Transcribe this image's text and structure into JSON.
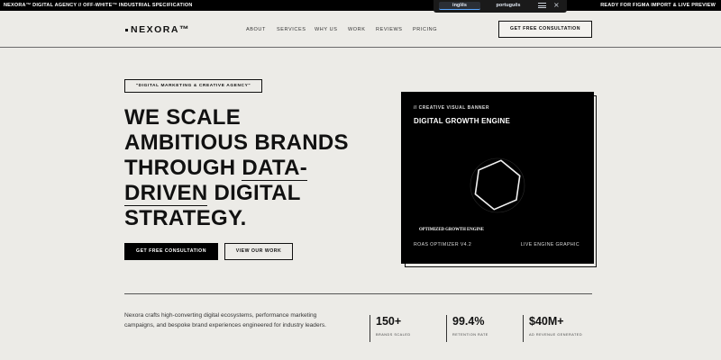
{
  "topbar": {
    "left_text": "NEXORA™ DIGITAL AGENCY // OFF-WHITE™ INDUSTRIAL SPECIFICATION",
    "right_text": "READY FOR FIGMA IMPORT & LIVE PREVIEW"
  },
  "language_switcher": {
    "options": [
      "inglês",
      "português"
    ],
    "selected": "inglês",
    "close_glyph": "×",
    "accent_color": "#5aa7ff"
  },
  "nav": {
    "logo": "NEXORA™",
    "links": [
      "ABOUT",
      "SERVICES",
      "WHY US",
      "WORK",
      "REVIEWS",
      "PRICING"
    ],
    "cta": "GET FREE CONSULTATION"
  },
  "hero": {
    "tag": "\"DIGITAL MARKETING & CREATIVE AGENCY\"",
    "headline": {
      "line1": "WE SCALE",
      "line2": "AMBITIOUS BRANDS",
      "line3_pre": "THROUGH ",
      "line3_ul": "DATA-",
      "line4_ul": "DRIVEN",
      "line4_post": " DIGITAL",
      "line5": "STRATEGY."
    },
    "primary_cta": "GET FREE CONSULTATION",
    "secondary_cta": "VIEW OUR WORK"
  },
  "banner": {
    "kicker": "// CREATIVE VISUAL BANNER",
    "title": "DIGITAL GROWTH ENGINE",
    "engine_label": "OPTIMIZED GROWTH ENGINE",
    "left_caption": "ROAS OPTIMIZER V4.2",
    "right_caption": "LIVE ENGINE GRAPHIC",
    "icon": "hexagon-icon"
  },
  "about": {
    "text": "Nexora crafts high-converting digital ecosystems, performance marketing campaigns, and bespoke brand experiences engineered for industry leaders."
  },
  "stats": [
    {
      "value": "150+",
      "label": "BRANDS SCALED"
    },
    {
      "value": "99.4%",
      "label": "RETENTION RATE"
    },
    {
      "value": "$40M+",
      "label": "AD REVENUE GENERATED"
    }
  ]
}
